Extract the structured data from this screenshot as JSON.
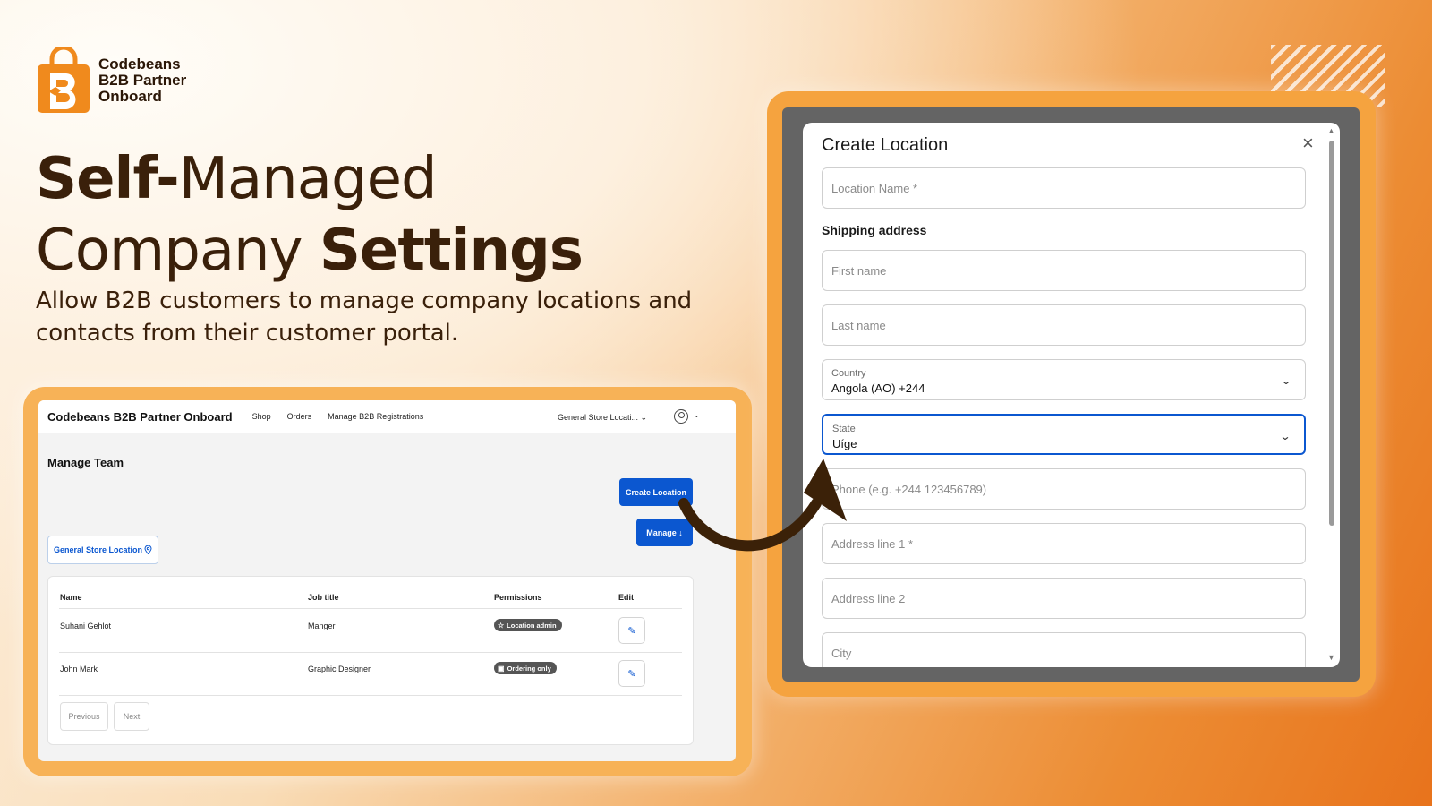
{
  "brand": {
    "name_lines": [
      "Codebeans",
      "B2B Partner",
      "Onboard"
    ]
  },
  "hero": {
    "line1_bold": "Self-",
    "line1_regular": "Managed",
    "line2_regular": "Company ",
    "line2_bold": "Settings",
    "subtitle": "Allow B2B customers to manage company locations and contacts from their customer portal."
  },
  "portal": {
    "brand": "Codebeans B2B Partner Onboard",
    "nav": [
      "Shop",
      "Orders",
      "Manage B2B Registrations"
    ],
    "store_selector": "General Store Locati... ⌄",
    "account_chevron": "⌄",
    "page_title": "Manage Team",
    "create_location_label": "Create Location",
    "manage_label": "Manage ↓",
    "location_pill": "General Store Location",
    "table": {
      "headers": [
        "Name",
        "Job title",
        "Permissions",
        "Edit"
      ],
      "rows": [
        {
          "name": "Suhani Gehlot",
          "job": "Manger",
          "permission": "Location admin",
          "permission_icon": "☆"
        },
        {
          "name": "John Mark",
          "job": "Graphic Designer",
          "permission": "Ordering only",
          "permission_icon": "▣"
        }
      ]
    },
    "previous_label": "Previous",
    "next_label": "Next"
  },
  "modal": {
    "title": "Create Location",
    "close_icon": "×",
    "location_name_placeholder": "Location Name *",
    "shipping_heading": "Shipping address",
    "first_name_placeholder": "First name",
    "last_name_placeholder": "Last name",
    "country_label": "Country",
    "country_value": "Angola (AO) +244",
    "state_label": "State",
    "state_value": "Uíge",
    "phone_placeholder": "Phone (e.g. +244 123456789)",
    "address1_placeholder": "Address line 1 *",
    "address2_placeholder": "Address line 2",
    "city_placeholder": "City"
  },
  "colors": {
    "accent_blue": "#0b57d0",
    "brand_orange": "#f08a1d",
    "hero_text": "#3a200a"
  }
}
